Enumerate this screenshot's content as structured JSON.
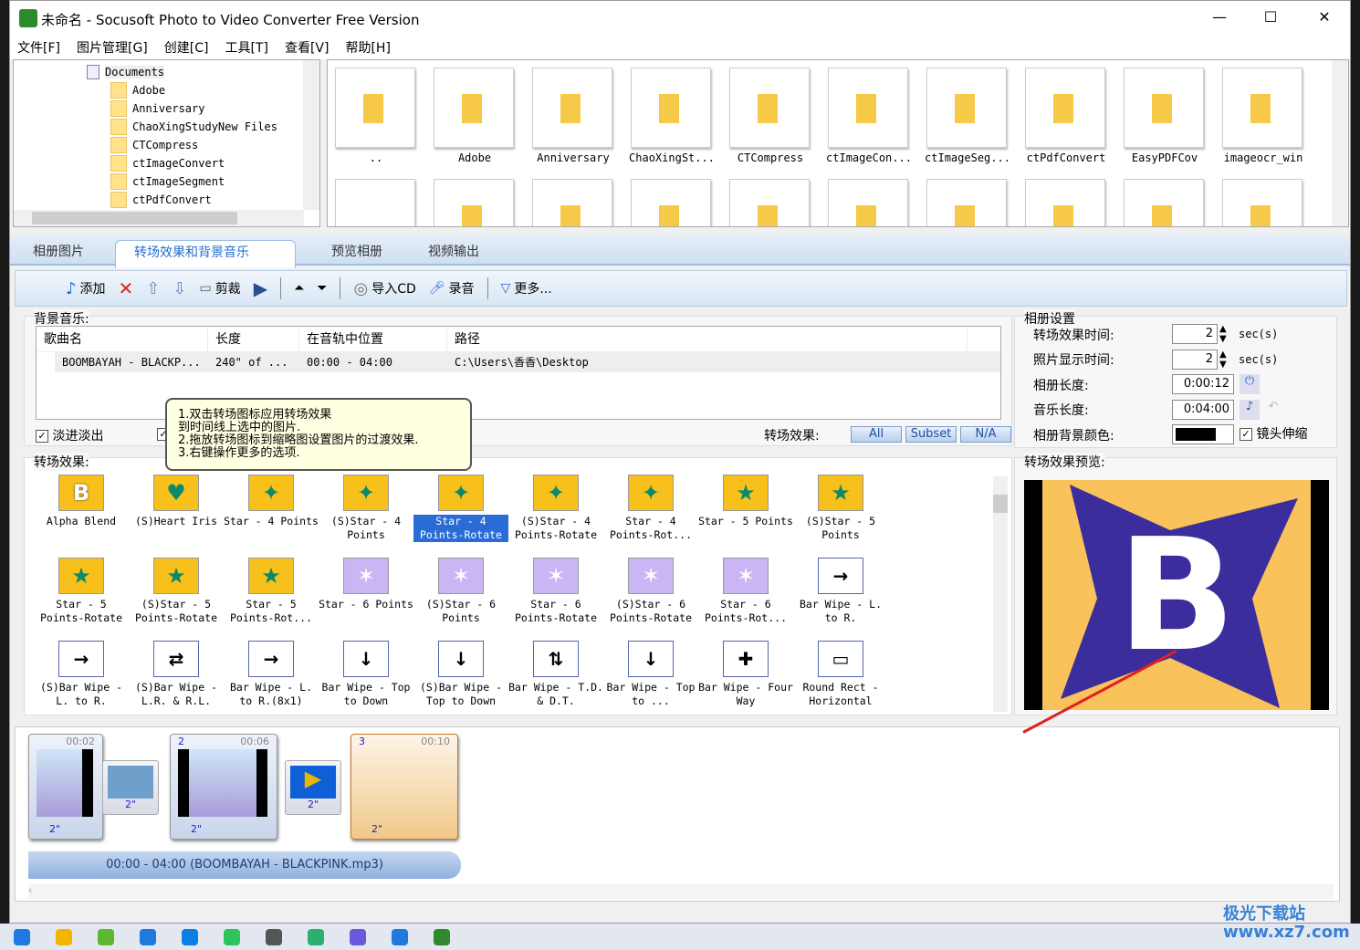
{
  "window": {
    "title": "未命名 - Socusoft Photo to Video Converter Free Version",
    "min": "—",
    "max": "☐",
    "close": "✕"
  },
  "menu": [
    "文件[F]",
    "图片管理[G]",
    "创建[C]",
    "工具[T]",
    "查看[V]",
    "帮助[H]"
  ],
  "tree": {
    "root": "Documents",
    "items": [
      "Adobe",
      "Anniversary",
      "ChaoXingStudyNew Files",
      "CTCompress",
      "ctImageConvert",
      "ctImageSegment",
      "ctPdfConvert"
    ]
  },
  "files": [
    "..",
    "Adobe",
    "Anniversary",
    "ChaoXingSt...",
    "CTCompress",
    "ctImageCon...",
    "ctImageSeg...",
    "ctPdfConvert",
    "EasyPDFCov",
    "imageocr_win"
  ],
  "tabs": [
    "相册图片",
    "转场效果和背景音乐",
    "预览相册",
    "视频输出"
  ],
  "active_tab": 1,
  "toolbar": {
    "add": "添加",
    "crop": "剪裁",
    "import_cd": "导入CD",
    "record": "录音",
    "more": "更多..."
  },
  "music": {
    "label": "背景音乐:",
    "columns": [
      "歌曲名",
      "长度",
      "在音轨中位置",
      "路径"
    ],
    "rows": [
      [
        "BOOMBAYAH - BLACKP...",
        "240\" of ...",
        "00:00 - 04:00",
        "C:\\Users\\香香\\Desktop"
      ]
    ],
    "fade": "淡进淡出",
    "fade_checked": true
  },
  "tooltip": [
    "1.双击转场图标应用转场效果",
    "到时间线上选中的图片.",
    "2.拖放转场图标到缩略图设置图片的过渡效果.",
    "3.右键操作更多的选项."
  ],
  "effects": {
    "label": "转场效果:",
    "filter_label": "转场效果:",
    "filters": [
      "All",
      "Subset",
      "N/A"
    ],
    "items": [
      {
        "name": "Alpha Blend",
        "glyph": "B",
        "style": "y"
      },
      {
        "name": "(S)Heart Iris",
        "glyph": "♥",
        "style": "y"
      },
      {
        "name": "Star - 4 Points",
        "glyph": "✦",
        "style": "y"
      },
      {
        "name": "(S)Star - 4 Points",
        "glyph": "✦",
        "style": "y"
      },
      {
        "name": "Star - 4 Points-Rotate",
        "glyph": "✦",
        "style": "y"
      },
      {
        "name": "(S)Star - 4 Points-Rotate",
        "glyph": "✦",
        "style": "y"
      },
      {
        "name": "Star - 4 Points-Rot...",
        "glyph": "✦",
        "style": "y"
      },
      {
        "name": "Star - 5 Points",
        "glyph": "★",
        "style": "y"
      },
      {
        "name": "(S)Star - 5 Points",
        "glyph": "★",
        "style": "y"
      },
      {
        "name": "Star - 5 Points-Rotate",
        "glyph": "★",
        "style": "y"
      },
      {
        "name": "(S)Star - 5 Points-Rotate",
        "glyph": "★",
        "style": "y"
      },
      {
        "name": "Star - 5 Points-Rot...",
        "glyph": "★",
        "style": "y"
      },
      {
        "name": "Star - 6 Points",
        "glyph": "✶",
        "style": "p"
      },
      {
        "name": "(S)Star - 6 Points",
        "glyph": "✶",
        "style": "p"
      },
      {
        "name": "Star - 6 Points-Rotate",
        "glyph": "✶",
        "style": "p"
      },
      {
        "name": "(S)Star - 6 Points-Rotate",
        "glyph": "✶",
        "style": "p"
      },
      {
        "name": "Star - 6 Points-Rot...",
        "glyph": "✶",
        "style": "p"
      },
      {
        "name": "Bar Wipe - L. to R.",
        "glyph": "→",
        "style": "b"
      },
      {
        "name": "(S)Bar Wipe - L. to R.",
        "glyph": "→",
        "style": "b"
      },
      {
        "name": "(S)Bar Wipe - L.R. & R.L.",
        "glyph": "⇄",
        "style": "b"
      },
      {
        "name": "Bar Wipe - L. to R.(8x1)",
        "glyph": "→",
        "style": "b"
      },
      {
        "name": "Bar Wipe - Top to Down",
        "glyph": "↓",
        "style": "b"
      },
      {
        "name": "(S)Bar Wipe - Top to Down",
        "glyph": "↓",
        "style": "b"
      },
      {
        "name": "Bar Wipe - T.D. & D.T.",
        "glyph": "⇅",
        "style": "b"
      },
      {
        "name": "Bar Wipe - Top to ...",
        "glyph": "↓",
        "style": "b"
      },
      {
        "name": "Bar Wipe - Four Way",
        "glyph": "✚",
        "style": "b"
      },
      {
        "name": "Round Rect - Horizontal",
        "glyph": "▭",
        "style": "b"
      }
    ],
    "selected": 4
  },
  "settings": {
    "title": "相册设置",
    "transition_time_label": "转场效果时间:",
    "transition_time": "2",
    "photo_time_label": "照片显示时间:",
    "photo_time": "2",
    "unit": "sec(s)",
    "album_len_label": "相册长度:",
    "album_len": "0:00:12",
    "music_len_label": "音乐长度:",
    "music_len": "0:04:00",
    "bg_color_label": "相册背景颜色:",
    "bg_color": "#000000",
    "zoom_label": "镜头伸缩",
    "zoom_checked": true
  },
  "preview": {
    "label": "转场效果预览:",
    "letter": "B"
  },
  "timeline": {
    "clips": [
      {
        "num": "",
        "time": "00:02",
        "dur": "2\""
      },
      {
        "num": "2",
        "time": "00:06",
        "dur": "2\""
      },
      {
        "num": "3",
        "time": "00:10",
        "dur": "2\""
      }
    ],
    "transitions": [
      "2\"",
      "2\""
    ],
    "audio": "00:00 - 04:00 (BOOMBAYAH - BLACKPINK.mp3)"
  },
  "watermark": "极光下载站 www.xz7.com",
  "colors": {
    "accent": "#2a6cd6",
    "tab_text": "#1f6fd1",
    "preview_bg": "#f9c25a",
    "preview_star": "#3b2e9c"
  }
}
